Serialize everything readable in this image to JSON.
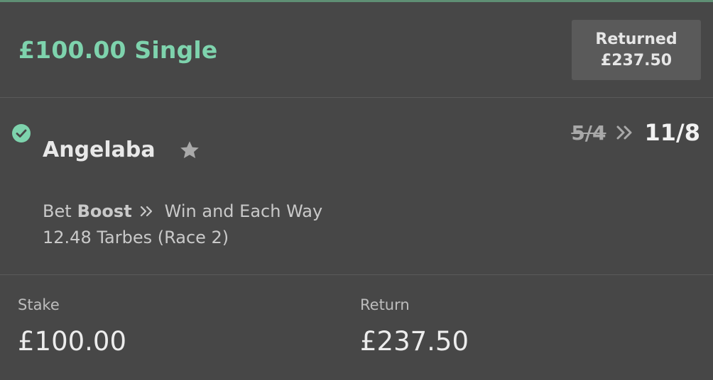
{
  "bet": {
    "title": "£100.00 Single",
    "status_label": "Returned",
    "status_amount": "£237.50"
  },
  "selection": {
    "name": "Angelaba",
    "old_odds": "5/4",
    "new_odds": "11/8",
    "bet_prefix": "Bet",
    "boost_label": "Boost",
    "market": "Win and Each Way",
    "event": "12.48 Tarbes (Race 2)",
    "icons": {
      "status": "check-circle-icon",
      "favorite": "star-icon",
      "odds_change": "double-chevron-right-icon"
    }
  },
  "summary": {
    "stake_label": "Stake",
    "stake_value": "£100.00",
    "return_label": "Return",
    "return_value": "£237.50"
  },
  "colors": {
    "background": "#474747",
    "accent_green": "#7ed3ad",
    "status_box": "#5a5a5a"
  }
}
